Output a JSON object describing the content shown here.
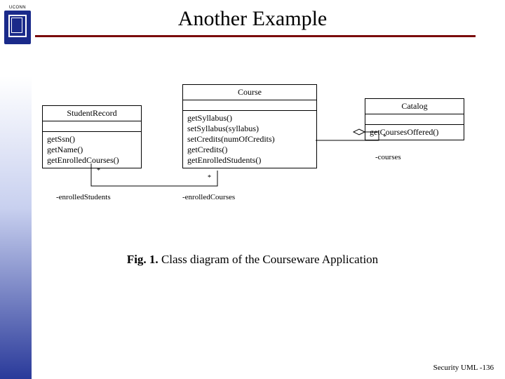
{
  "header": {
    "title": "Another Example",
    "logo_label": "UCONN"
  },
  "diagram": {
    "classes": {
      "studentRecord": {
        "name": "StudentRecord",
        "ops": [
          "getSsn()",
          "getName()",
          "getEnrolledCourses()"
        ]
      },
      "course": {
        "name": "Course",
        "ops": [
          "getSyllabus()",
          "setSyllabus(syllabus)",
          "setCredits(numOfCredits)",
          "getCredits()",
          "getEnrolledStudents()"
        ]
      },
      "catalog": {
        "name": "Catalog",
        "ops": [
          "getCoursesOffered()"
        ]
      }
    },
    "associations": {
      "sr_course": {
        "role_left": "-enrolledStudents",
        "role_right": "-enrolledCourses",
        "mult_left": "*",
        "mult_right": "*"
      },
      "course_catalog": {
        "role": "-courses",
        "mult": "*"
      }
    },
    "caption_label": "Fig. 1.",
    "caption_text": "Class diagram of the Courseware Application"
  },
  "footer": {
    "text": "Security UML -136"
  }
}
